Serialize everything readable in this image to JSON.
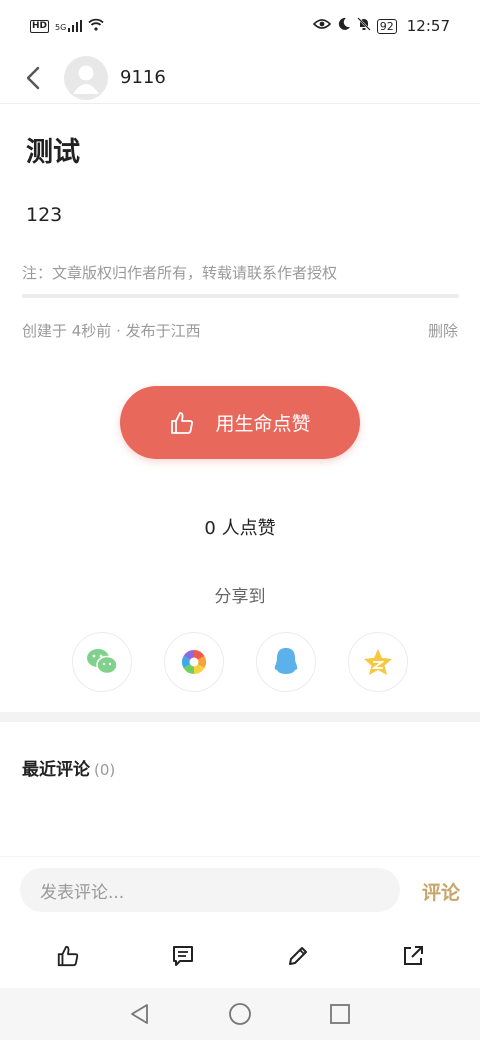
{
  "status_bar": {
    "network": "HD",
    "signal": "5G",
    "battery": "92",
    "time": "12:57"
  },
  "header": {
    "author_name": "9116"
  },
  "post": {
    "title": "测试",
    "body": "123",
    "copyright_notice": "注：文章版权归作者所有，转载请联系作者授权",
    "meta": "创建于 4秒前 · 发布于江西",
    "delete_label": "删除"
  },
  "like": {
    "button_label": "用生命点赞",
    "count_text": "0 人点赞"
  },
  "share": {
    "title": "分享到",
    "targets": [
      "wechat-icon",
      "moments-icon",
      "qq-icon",
      "qzone-icon"
    ]
  },
  "comments": {
    "title": "最近评论",
    "count": "(0)",
    "input_placeholder": "发表评论...",
    "submit_label": "评论"
  },
  "colors": {
    "accent": "#e8685c",
    "submit": "#c9a46b"
  }
}
